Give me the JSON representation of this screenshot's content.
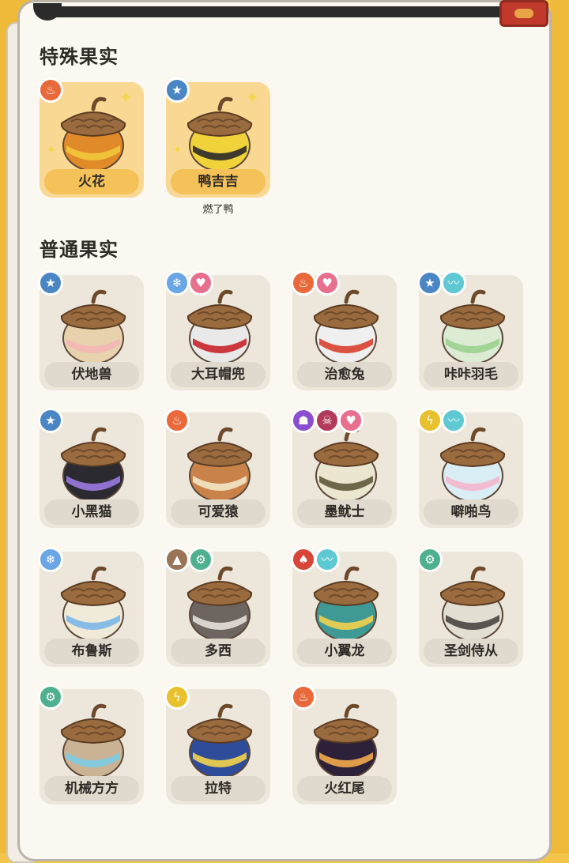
{
  "sections": {
    "special_title": "特殊果实",
    "normal_title": "普通果实"
  },
  "special": [
    {
      "name": "火花",
      "badges": [
        "fire"
      ],
      "body": "#e08a2a",
      "band": "#f2c83a"
    },
    {
      "name": "鸭吉吉",
      "sub": "燃了鸭",
      "badges": [
        "normal"
      ],
      "body": "#f0d23a",
      "band": "#2a2a2a"
    }
  ],
  "normal": [
    {
      "name": "伏地兽",
      "badges": [
        "normal"
      ],
      "body": "#e8d2ae",
      "band": "#f3b6b6"
    },
    {
      "name": "大耳帽兜",
      "badges": [
        "ice",
        "fairy"
      ],
      "body": "#e9e9e9",
      "band": "#c8252a"
    },
    {
      "name": "治愈兔",
      "badges": [
        "fire",
        "fairy"
      ],
      "body": "#efefef",
      "band": "#d8402f"
    },
    {
      "name": "咔咔羽毛",
      "badges": [
        "normal",
        "wing"
      ],
      "body": "#dcebd4",
      "band": "#9bd18f"
    },
    {
      "name": "小黑猫",
      "badges": [
        "normal"
      ],
      "body": "#2a2a30",
      "band": "#9b7ae0"
    },
    {
      "name": "可爱猿",
      "badges": [
        "fire"
      ],
      "body": "#c8824a",
      "band": "#f2e6c8"
    },
    {
      "name": "墨鱿士",
      "badges": [
        "ghost",
        "demon",
        "fairy"
      ],
      "body": "#eae6cf",
      "band": "#5f5a3a"
    },
    {
      "name": "噼啪鸟",
      "badges": [
        "electric",
        "wing"
      ],
      "body": "#d9eef4",
      "band": "#f4b6cc"
    },
    {
      "name": "布鲁斯",
      "badges": [
        "ice"
      ],
      "body": "#f0ead9",
      "band": "#7bb7e8"
    },
    {
      "name": "多西",
      "badges": [
        "ground",
        "mech"
      ],
      "body": "#6c6560",
      "band": "#e6e1da"
    },
    {
      "name": "小翼龙",
      "badges": [
        "dragon",
        "wing"
      ],
      "body": "#3f9a95",
      "band": "#f2d14c"
    },
    {
      "name": "圣剑侍从",
      "badges": [
        "mech"
      ],
      "body": "#e2ded2",
      "band": "#4a4540"
    },
    {
      "name": "机械方方",
      "badges": [
        "mech"
      ],
      "body": "#c9b394",
      "band": "#7dcbe4"
    },
    {
      "name": "拉特",
      "badges": [
        "electric"
      ],
      "body": "#2e4c99",
      "band": "#f4d44a"
    },
    {
      "name": "火红尾",
      "badges": [
        "fire"
      ],
      "body": "#2c2138",
      "band": "#f2a84a"
    }
  ],
  "badge_styles": {
    "fire": {
      "color": "#e9693a",
      "glyph": "♨",
      "icon": "fire-icon"
    },
    "normal": {
      "color": "#4b86c4",
      "glyph": "★",
      "icon": "star-icon"
    },
    "ice": {
      "color": "#6aa6e6",
      "glyph": "❄",
      "icon": "snowflake-icon"
    },
    "fairy": {
      "color": "#e8708f",
      "glyph": "♥",
      "icon": "heart-icon"
    },
    "wing": {
      "color": "#5ec8d3",
      "glyph": "〰",
      "icon": "wing-icon"
    },
    "ghost": {
      "color": "#8a4fd0",
      "glyph": "☗",
      "icon": "ghost-icon"
    },
    "demon": {
      "color": "#b33a5a",
      "glyph": "☠",
      "icon": "demon-icon"
    },
    "electric": {
      "color": "#e8c22e",
      "glyph": "ϟ",
      "icon": "lightning-icon"
    },
    "ground": {
      "color": "#9a7456",
      "glyph": "▲",
      "icon": "mountain-icon"
    },
    "mech": {
      "color": "#4fb08f",
      "glyph": "⚙",
      "icon": "gear-icon"
    },
    "dragon": {
      "color": "#d8463a",
      "glyph": "♠",
      "icon": "dragon-icon"
    }
  }
}
